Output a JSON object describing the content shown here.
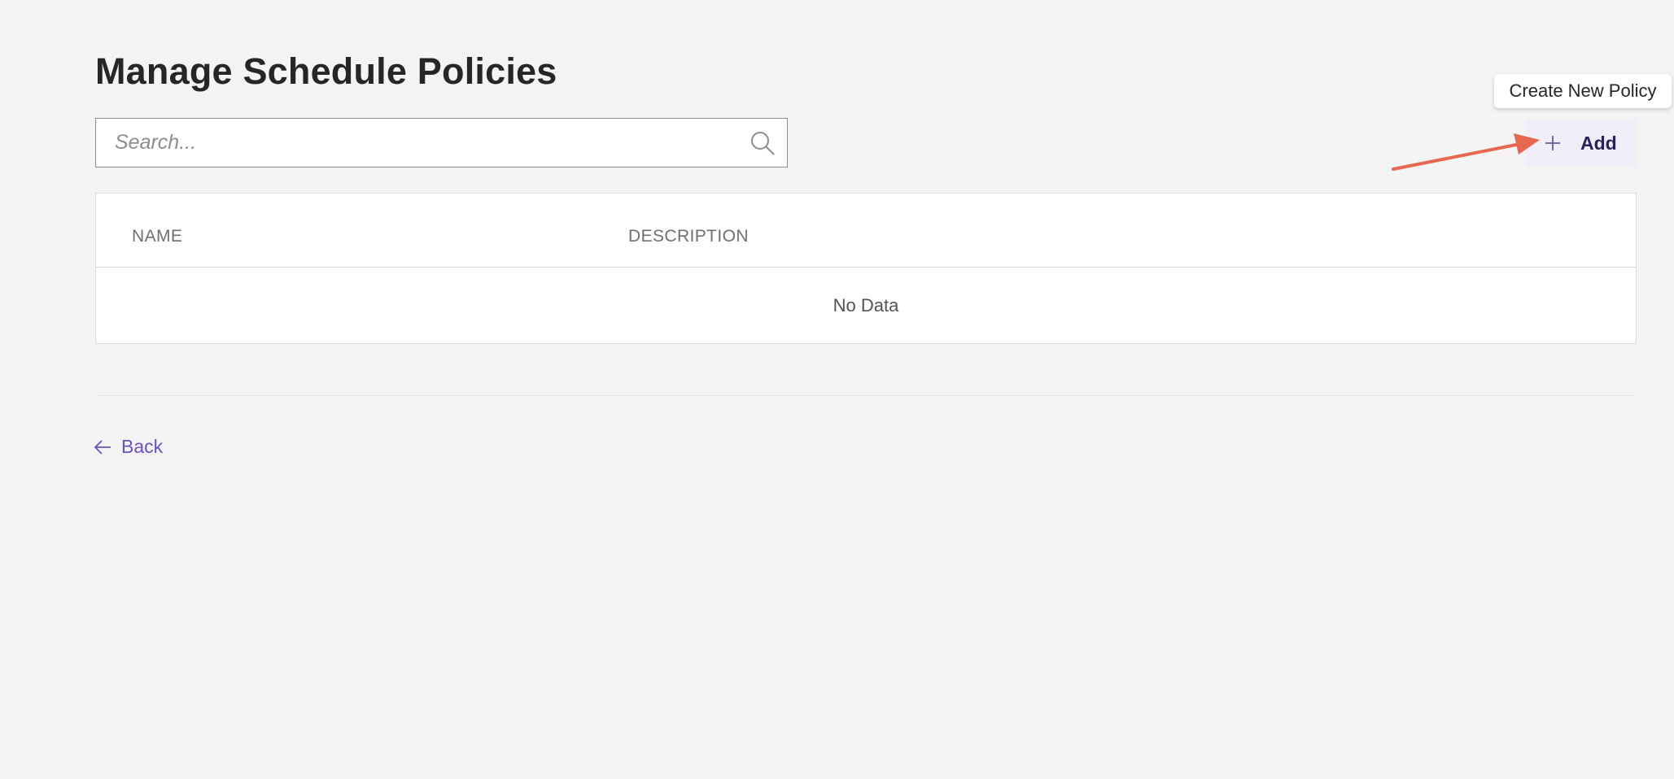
{
  "page": {
    "title": "Manage Schedule Policies"
  },
  "search": {
    "placeholder": "Search...",
    "value": "",
    "icon": "search-icon"
  },
  "toolbar": {
    "add_label": "Add",
    "add_icon": "plus-icon",
    "tooltip": "Create New Policy",
    "annotation_color": "#e8684f"
  },
  "table": {
    "columns": [
      "NAME",
      "DESCRIPTION"
    ],
    "rows": [],
    "empty_text": "No Data"
  },
  "footer": {
    "back_label": "Back",
    "back_icon": "arrow-left-icon"
  },
  "colors": {
    "accent": "#6a4fc9",
    "button_bg": "#f1eefa",
    "page_bg": "#f4f4f4"
  }
}
